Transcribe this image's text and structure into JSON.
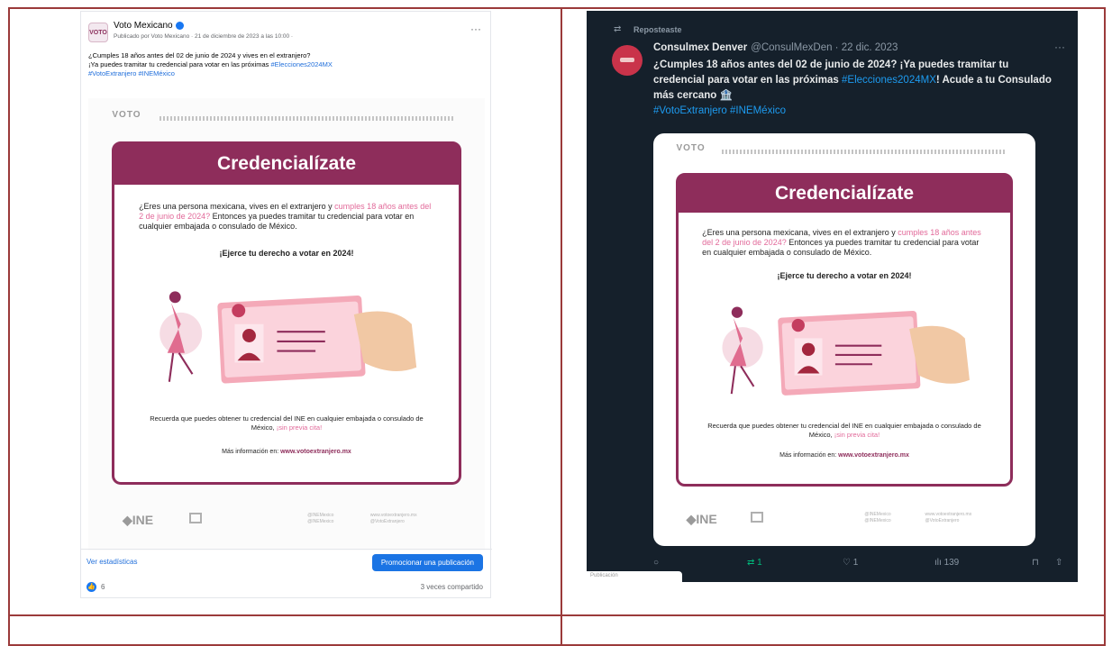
{
  "facebook_post": {
    "logo_text": "VOTO",
    "page_name": "Voto Mexicano",
    "meta": "Publicado por Voto Mexicano · 21 de diciembre de 2023 a las 10:00 ·",
    "body_line1": "¿Cumples 18 años antes del 02 de junio de 2024 y vives en el extranjero?",
    "body_line2": "¡Ya puedes tramitar tu credencial para votar en las próximas",
    "hashtag1": "#Elecciones2024MX",
    "hashtag2": "#VotoExtranjero",
    "hashtag3": "#INEMéxico",
    "view_stats": "Ver estadísticas",
    "promote_button": "Promocionar una publicación",
    "like_count": "6",
    "share_count": "3 veces compartido",
    "more_icon": "more-horizontal-icon"
  },
  "tweet": {
    "repost_label": "Reposteaste",
    "account_name": "Consulmex Denver",
    "handle_date": "@ConsulMexDen · 22 dic. 2023",
    "body_part1": "¿Cumples 18 años antes del 02 de junio de 2024? ¡Ya puedes tramitar tu credencial para votar en las próximas ",
    "hashtag1": "#Elecciones2024MX",
    "body_part2": "! Acude a tu Consulado más cercano 🏦",
    "hashtags_line": "#VotoExtranjero #INEMéxico",
    "reply_count": "",
    "repost_count": "1",
    "like_count": "1",
    "views_count": "139",
    "toast_text": "Publicación"
  },
  "poster": {
    "voto_label": "VOTO",
    "title": "Credencialízate",
    "para_start": "¿Eres una persona mexicana, vives en el extranjero y ",
    "para_pink": "cumples 18 años antes del 2 de junio de 2024?",
    "para_end": " Entonces ya puedes tramitar tu credencial para votar en cualquier embajada o consulado de México.",
    "exhort": "¡Ejerce tu derecho a votar en 2024!",
    "recuerda": "Recuerda que puedes obtener tu credencial del INE en cualquier embajada o consulado de México, ",
    "recuerda_pink": "¡sin previa cita!",
    "mas_info": "Más información en: ",
    "website": "www.votoextranjero.mx",
    "ine_label": "◆INE",
    "social_1": "@INEMexico",
    "social_2": "@INEMexico",
    "social_3": "www.votoextranjero.mx",
    "social_4": "@VotoExtranjero"
  },
  "colors": {
    "brand": "#8e2d5b",
    "pink": "#e26a9a",
    "twitter_bg": "#15202b",
    "facebook_blue": "#1b74e4",
    "border": "#9b3a3a"
  }
}
